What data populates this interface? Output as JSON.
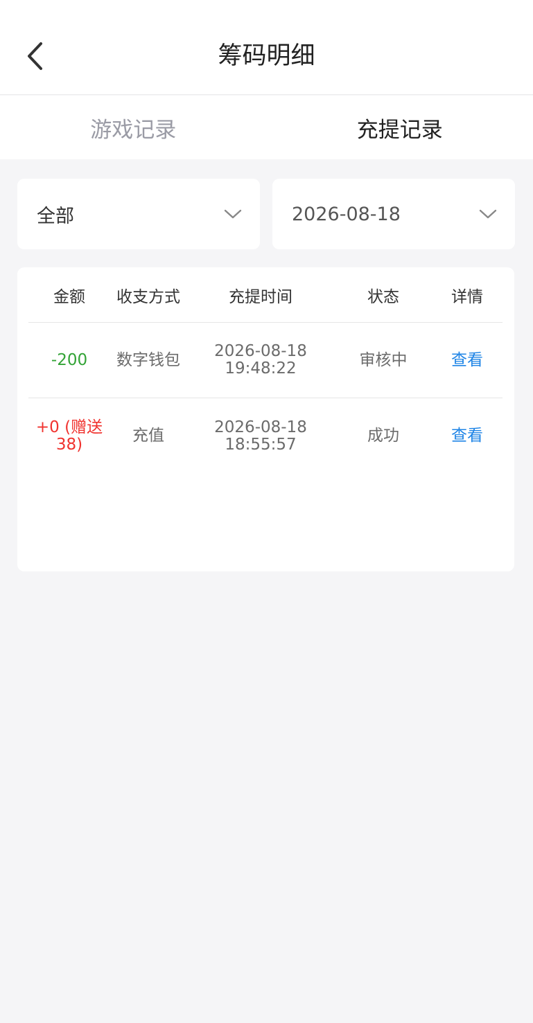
{
  "header": {
    "title": "筹码明细"
  },
  "tabs": [
    {
      "label": "游戏记录",
      "active": false
    },
    {
      "label": "充提记录",
      "active": true
    }
  ],
  "filters": {
    "type": {
      "value": "全部"
    },
    "date": {
      "value": "2026-08-18"
    }
  },
  "table": {
    "columns": [
      "金额",
      "收支方式",
      "充提时间",
      "状态",
      "详情"
    ],
    "rows": [
      {
        "amount": "-200",
        "amount_color": "#33a336",
        "method": "数字钱包",
        "date": "2026-08-18",
        "time": "19:48:22",
        "status": "审核中",
        "detail": "查看"
      },
      {
        "amount": "+0 (赠送38)",
        "amount_color": "#f0332f",
        "method": "充值",
        "date": "2026-08-18",
        "time": "18:55:57",
        "status": "成功",
        "detail": "查看"
      }
    ]
  },
  "colors": {
    "link": "#1e84e6",
    "negative": "#33a336",
    "positive": "#f0332f"
  },
  "icons": {
    "back": "chevron-left-icon",
    "dropdown": "chevron-down-icon"
  }
}
